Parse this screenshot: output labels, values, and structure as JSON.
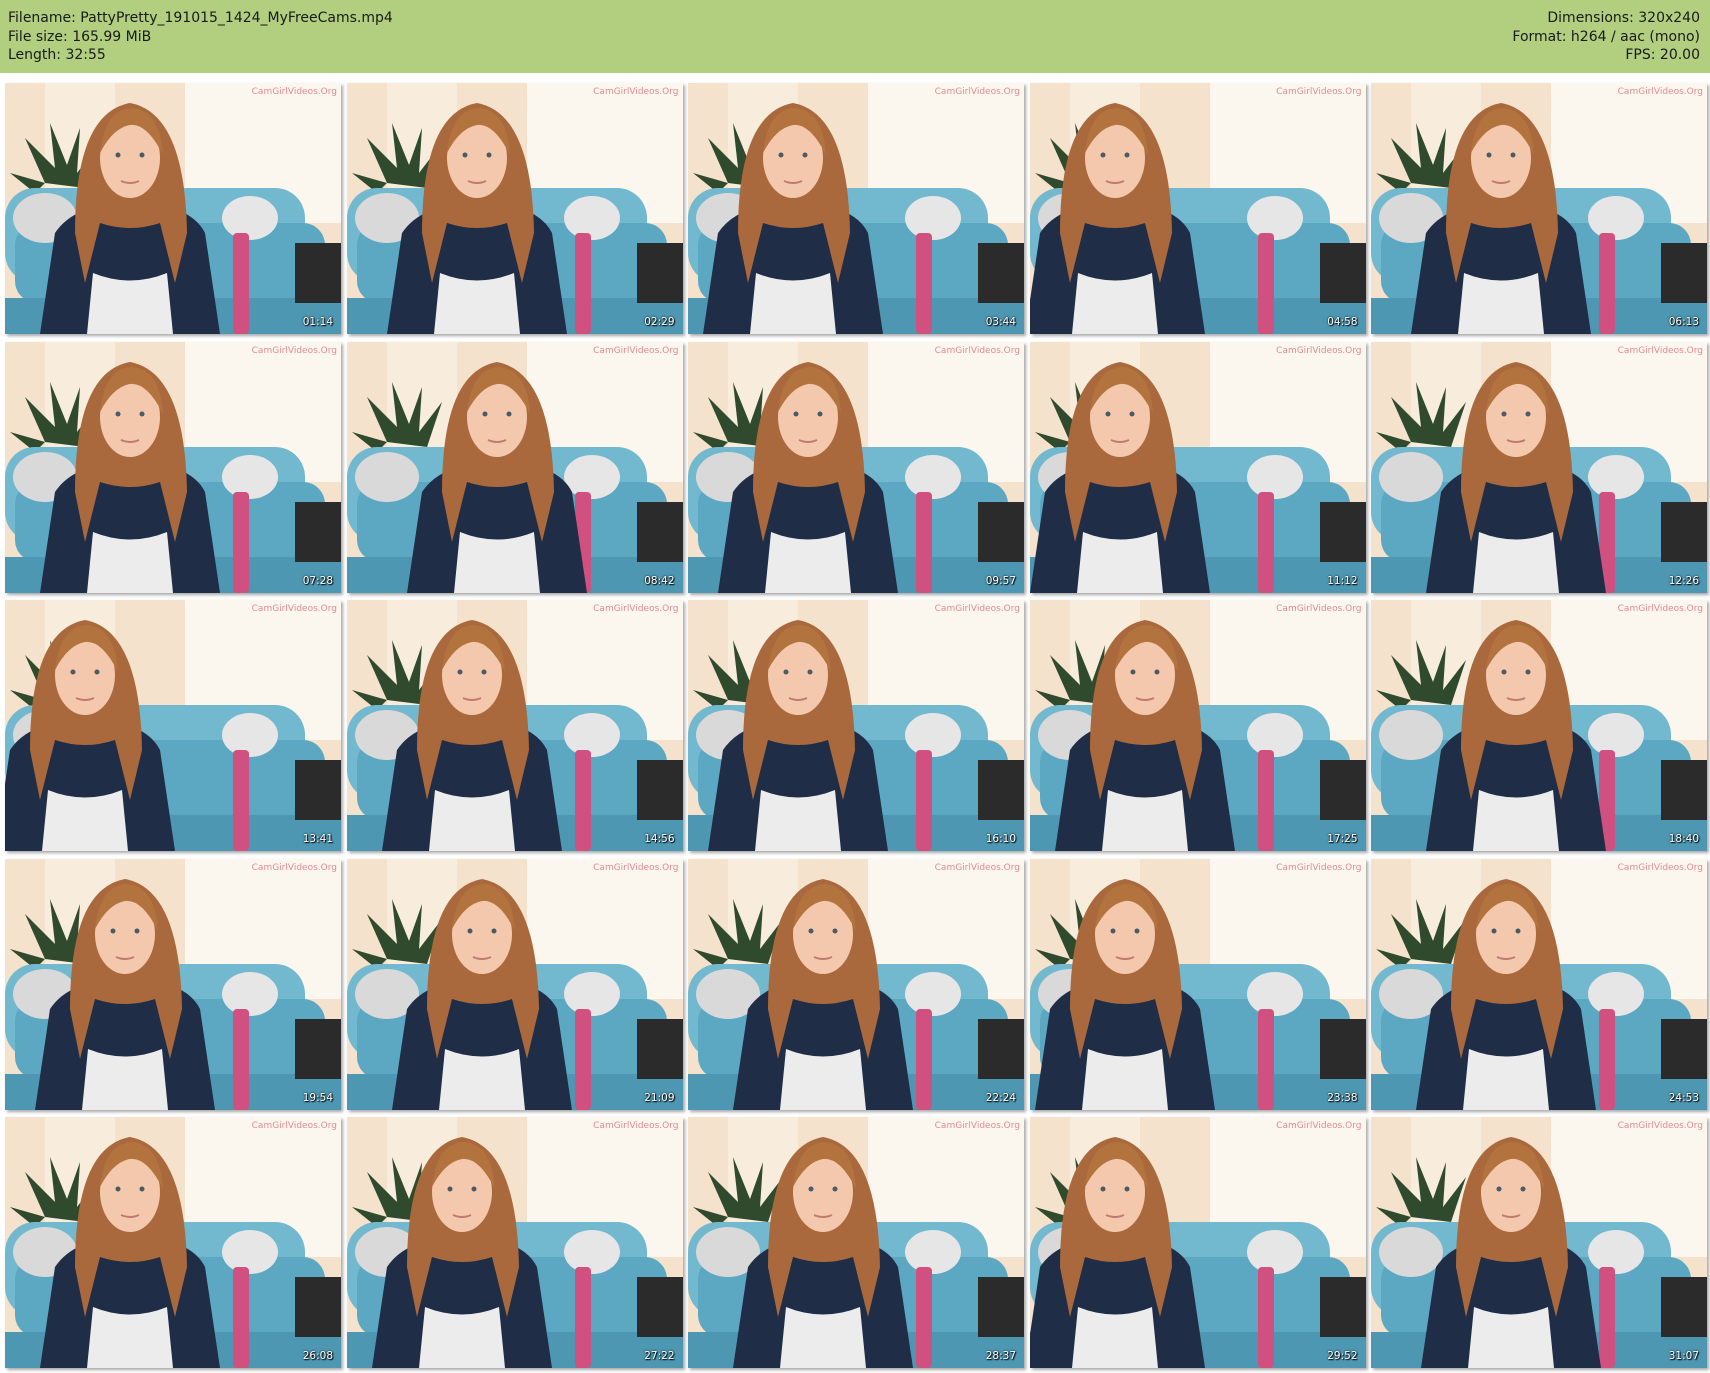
{
  "header": {
    "left": [
      "Filename: PattyPretty_191015_1424_MyFreeCams.mp4",
      "File size: 165.99 MiB",
      "Length: 32:55"
    ],
    "right": [
      "Dimensions: 320x240",
      "Format: h264 / aac (mono)",
      "FPS: 20.00"
    ],
    "background_color": "#b2cf80"
  },
  "thumbnails": [
    {
      "timestamp": "01:14"
    },
    {
      "timestamp": "02:29"
    },
    {
      "timestamp": "03:44"
    },
    {
      "timestamp": "04:58"
    },
    {
      "timestamp": "06:13"
    },
    {
      "timestamp": "07:28"
    },
    {
      "timestamp": "08:42"
    },
    {
      "timestamp": "09:57"
    },
    {
      "timestamp": "11:12"
    },
    {
      "timestamp": "12:26"
    },
    {
      "timestamp": "13:41"
    },
    {
      "timestamp": "14:56"
    },
    {
      "timestamp": "16:10"
    },
    {
      "timestamp": "17:25"
    },
    {
      "timestamp": "18:40"
    },
    {
      "timestamp": "19:54"
    },
    {
      "timestamp": "21:09"
    },
    {
      "timestamp": "22:24"
    },
    {
      "timestamp": "23:38"
    },
    {
      "timestamp": "24:53"
    },
    {
      "timestamp": "26:08"
    },
    {
      "timestamp": "27:22"
    },
    {
      "timestamp": "28:37"
    },
    {
      "timestamp": "29:52"
    },
    {
      "timestamp": "31:07"
    }
  ],
  "watermark": "CamGirlVideos.Org"
}
